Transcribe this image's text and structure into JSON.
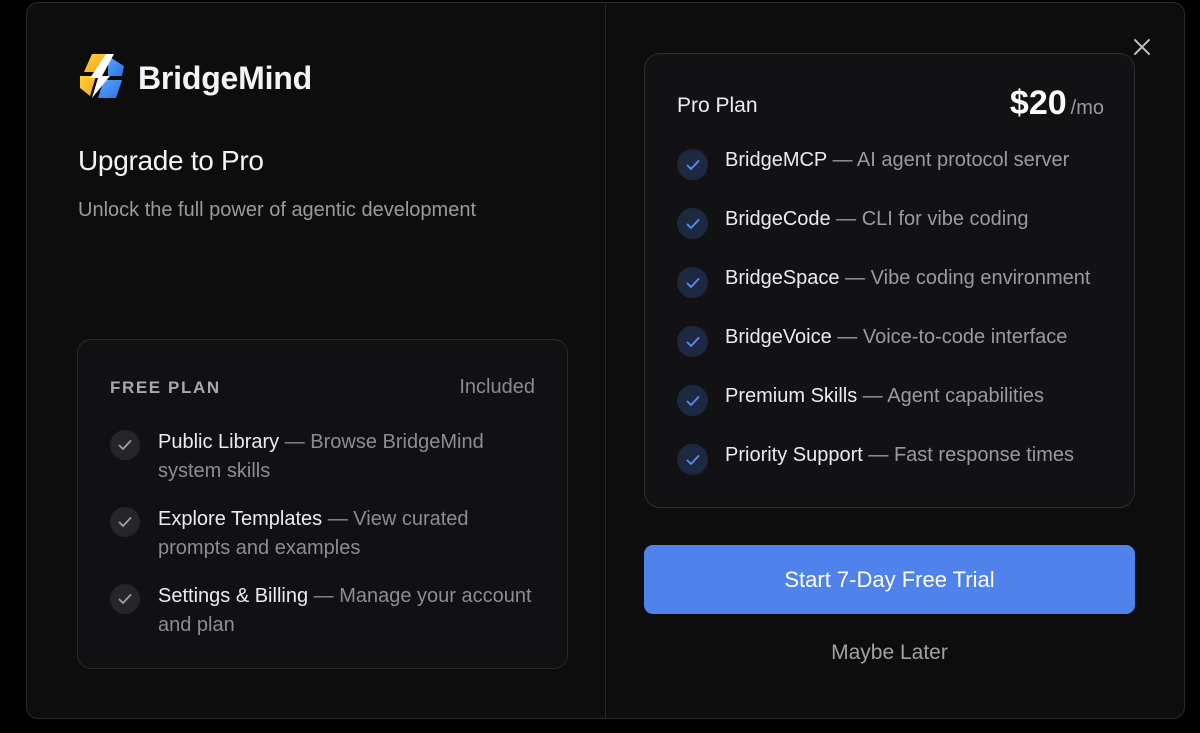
{
  "brand": {
    "name": "BridgeMind"
  },
  "header": {
    "title": "Upgrade to Pro",
    "subtitle": "Unlock the full power of agentic development"
  },
  "free_plan": {
    "label": "FREE PLAN",
    "status": "Included",
    "items": [
      {
        "name": "Public Library",
        "desc": " — Browse BridgeMind system skills"
      },
      {
        "name": "Explore Templates",
        "desc": " — View curated prompts and examples"
      },
      {
        "name": "Settings & Billing",
        "desc": " — Manage your account and plan"
      }
    ]
  },
  "pro_plan": {
    "name": "Pro Plan",
    "price": "$20",
    "period": "/mo",
    "items": [
      {
        "name": "BridgeMCP",
        "desc": " — AI agent protocol server"
      },
      {
        "name": "BridgeCode",
        "desc": " — CLI for vibe coding"
      },
      {
        "name": "BridgeSpace",
        "desc": " — Vibe coding environment"
      },
      {
        "name": "BridgeVoice",
        "desc": " — Voice-to-code interface"
      },
      {
        "name": "Premium Skills",
        "desc": " — Agent capabilities"
      },
      {
        "name": "Priority Support",
        "desc": " — Fast response times"
      }
    ]
  },
  "actions": {
    "primary_label": "Start 7-Day Free Trial",
    "secondary_label": "Maybe Later"
  },
  "icons": {
    "close": "close-icon",
    "check": "check-icon",
    "logo": "lightning-logo-icon"
  },
  "colors": {
    "accent": "#4f82eb",
    "check_pro": "#5b8bf0",
    "background": "#0d0d0e"
  }
}
